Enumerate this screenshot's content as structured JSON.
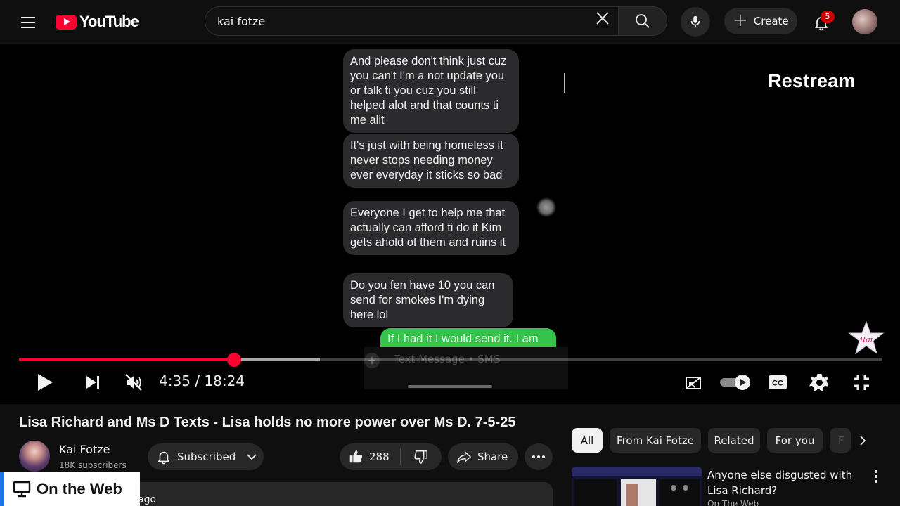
{
  "header": {
    "logo_text": "YouTube",
    "search_value": "kai fotze",
    "create_label": "Create",
    "notification_count": "5",
    "icons": [
      "menu-icon",
      "youtube-logo",
      "close-icon",
      "search-icon",
      "mic-icon",
      "plus-icon",
      "bell-icon",
      "avatar"
    ]
  },
  "player": {
    "overlay_brand": "Restream",
    "messages_in": [
      "And please don't think just cuz you can't I'm a not update you or talk ti you cuz you still helped alot and that counts ti me alit",
      "It's just with being homeless it never stops needing money ever everyday it sticks so bad",
      "Everyone I get to help me that actually can afford ti do it Kim gets ahold of them and ruins it",
      "Do you fen have 10 you can send for smokes I'm dying here lol"
    ],
    "message_out": "If I had it I would send it. I am",
    "composer_placeholder": "Text Message • SMS",
    "star_logo_text": "Rai",
    "time_current": "4:35",
    "time_separator": "/",
    "time_total": "18:24",
    "played_fraction": 0.249,
    "buffered_fraction": 0.349,
    "colors": {
      "played": "#ff0033",
      "sms_out": "#34c24a"
    },
    "controls": [
      "play-icon",
      "next-icon",
      "mute-icon",
      "miniplayer-icon",
      "autoplay-toggle",
      "cc-icon",
      "settings-icon",
      "exit-fullscreen-icon"
    ]
  },
  "video": {
    "title": "Lisa Richard and Ms D Texts - Lisa holds no more power over Ms D. 7-5-25",
    "channel_name": "Kai Fotze",
    "subscribers": "18K subscribers",
    "subscribed_label": "Subscribed",
    "like_count": "288",
    "share_label": "Share",
    "description_snippet": "ago"
  },
  "overlay_badge": {
    "label": "On the Web"
  },
  "sidebar": {
    "chips": [
      {
        "label": "All",
        "active": true
      },
      {
        "label": "From Kai Fotze",
        "active": false
      },
      {
        "label": "Related",
        "active": false
      },
      {
        "label": "For you",
        "active": false
      },
      {
        "label": "F",
        "active": false
      }
    ],
    "recommendation": {
      "title": "Anyone else disgusted with Lisa Richard?",
      "channel": "On The Web"
    }
  }
}
